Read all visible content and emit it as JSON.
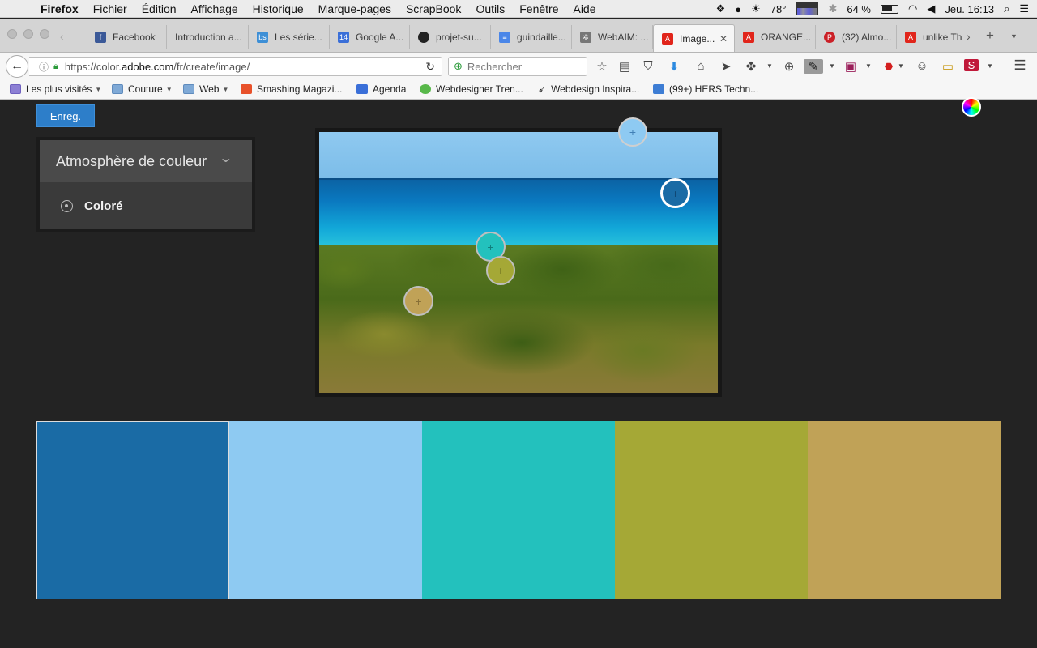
{
  "menubar": {
    "app": "Firefox",
    "menus": [
      "Fichier",
      "Édition",
      "Affichage",
      "Historique",
      "Marque-pages",
      "ScrapBook",
      "Outils",
      "Fenêtre",
      "Aide"
    ],
    "temperature": "78°",
    "battery": "64 %",
    "clock": "Jeu. 16:13"
  },
  "tabs": [
    {
      "label": "Facebook",
      "icon": "facebook-icon",
      "color": "#3b5998",
      "glyph": "f"
    },
    {
      "label": "Introduction a...",
      "icon": "",
      "color": "",
      "glyph": ""
    },
    {
      "label": "Les série...",
      "icon": "bs-icon",
      "color": "#3d8fd6",
      "glyph": "bs"
    },
    {
      "label": "Google A...",
      "icon": "calendar-icon",
      "color": "#3a6fd8",
      "glyph": "14"
    },
    {
      "label": "projet-su...",
      "icon": "github-icon",
      "color": "#222222",
      "glyph": "●"
    },
    {
      "label": "guindaille...",
      "icon": "docs-icon",
      "color": "#4a86e8",
      "glyph": "≡"
    },
    {
      "label": "WebAIM: ...",
      "icon": "webaim-icon",
      "color": "#666666",
      "glyph": "✲"
    },
    {
      "label": "Image...",
      "icon": "adobe-icon",
      "color": "#e1251b",
      "glyph": "A",
      "active": true
    },
    {
      "label": "ORANGE...",
      "icon": "adobe-icon",
      "color": "#e1251b",
      "glyph": "A"
    },
    {
      "label": "(32) Almo...",
      "icon": "pinterest-icon",
      "color": "#cb2027",
      "glyph": "P"
    },
    {
      "label": "unlike Th",
      "icon": "adobe-icon",
      "color": "#e1251b",
      "glyph": "A"
    }
  ],
  "navbar": {
    "url_prefix": "https://color.",
    "url_domain": "adobe.com",
    "url_path": "/fr/create/image/",
    "search_placeholder": "Rechercher"
  },
  "bookmarks": [
    {
      "label": "Les plus visités",
      "icon": "folder-icon",
      "dropdown": true
    },
    {
      "label": "Couture",
      "icon": "folder-icon",
      "dropdown": true
    },
    {
      "label": "Web",
      "icon": "folder-icon",
      "dropdown": true
    },
    {
      "label": "Smashing Magazi...",
      "icon": "smashing-icon",
      "dropdown": false
    },
    {
      "label": "Agenda",
      "icon": "calendar-icon",
      "dropdown": false
    },
    {
      "label": "Webdesigner Tren...",
      "icon": "wdd-icon",
      "dropdown": false
    },
    {
      "label": "Webdesign Inspira...",
      "icon": "cursor-icon",
      "dropdown": false
    },
    {
      "label": "(99+) HERS Techn...",
      "icon": "hers-icon",
      "dropdown": false
    }
  ],
  "page": {
    "save_label": "Enreg.",
    "mood_title": "Atmosphère de couleur",
    "mood_option": "Coloré"
  },
  "swatches": [
    {
      "color": "#1a6ba5",
      "selected": true
    },
    {
      "color": "#8ecaf2",
      "selected": false
    },
    {
      "color": "#23c1bd",
      "selected": false
    },
    {
      "color": "#a5a836",
      "selected": false
    },
    {
      "color": "#c0a257",
      "selected": false
    }
  ]
}
